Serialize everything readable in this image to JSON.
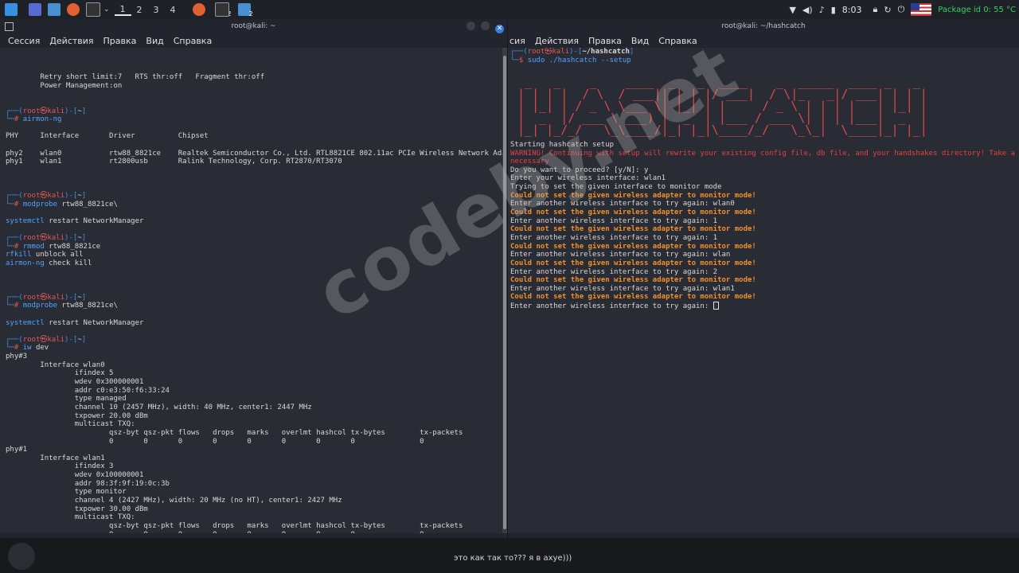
{
  "taskbar": {
    "workspaces": [
      "1",
      "2",
      "3",
      "4"
    ],
    "active_workspace": "1",
    "badge_a": "2",
    "badge_b": "2",
    "clock": "8:03",
    "package_status": "Package id 0: 55 °C"
  },
  "left_window": {
    "title": "root@kali: ~",
    "menu": [
      "Сессия",
      "Действия",
      "Правка",
      "Вид",
      "Справка"
    ],
    "lines": [
      {
        "t": "        Retry short limit:7   RTS thr:off   Fragment thr:off"
      },
      {
        "t": "        Power Management:on"
      },
      {
        "t": ""
      },
      {
        "t": ""
      },
      {
        "prompt": true,
        "host": "root㉿kali",
        "path": "~"
      },
      {
        "cmd": "airmon-ng"
      },
      {
        "t": ""
      },
      {
        "t": "PHY     Interface       Driver          Chipset"
      },
      {
        "t": ""
      },
      {
        "t": "phy2    wlan0           rtw88_8821ce    Realtek Semiconductor Co., Ltd. RTL8821CE 802.11ac PCIe Wireless Network Ada"
      },
      {
        "t": "phy1    wlan1           rt2800usb       Ralink Technology, Corp. RT2870/RT3070"
      },
      {
        "t": ""
      },
      {
        "t": ""
      },
      {
        "t": ""
      },
      {
        "prompt": true,
        "host": "root㉿kali",
        "path": "~"
      },
      {
        "cmd": "modprobe",
        "arg": "rtw88_8821ce\\"
      },
      {
        "t": ""
      },
      {
        "t2": "systemctl",
        "arg": "restart NetworkManager"
      },
      {
        "t": ""
      },
      {
        "prompt": true,
        "host": "root㉿kali",
        "path": "~"
      },
      {
        "cmd": "rmmod",
        "arg": "rtw88_8821ce"
      },
      {
        "t2": "rfkill",
        "arg": "unblock all"
      },
      {
        "t2": "airmon-ng",
        "arg": "check kill"
      },
      {
        "t": ""
      },
      {
        "t": ""
      },
      {
        "t": ""
      },
      {
        "prompt": true,
        "host": "root㉿kali",
        "path": "~"
      },
      {
        "cmd": "modprobe",
        "arg": "rtw88_8821ce\\"
      },
      {
        "t": ""
      },
      {
        "t2": "systemctl",
        "arg": "restart NetworkManager"
      },
      {
        "t": ""
      },
      {
        "prompt": true,
        "host": "root㉿kali",
        "path": "~"
      },
      {
        "cmd": "iw",
        "arg": "dev"
      },
      {
        "t": "phy#3"
      },
      {
        "t": "        Interface wlan0"
      },
      {
        "t": "                ifindex 5"
      },
      {
        "t": "                wdev 0x300000001"
      },
      {
        "t": "                addr c0:e3:50:f6:33:24"
      },
      {
        "t": "                type managed"
      },
      {
        "t": "                channel 10 (2457 MHz), width: 40 MHz, center1: 2447 MHz"
      },
      {
        "t": "                txpower 20.00 dBm"
      },
      {
        "t": "                multicast TXQ:"
      },
      {
        "t": "                        qsz-byt qsz-pkt flows   drops   marks   overlmt hashcol tx-bytes        tx-packets"
      },
      {
        "t": "                        0       0       0       0       0       0       0       0               0"
      },
      {
        "t": "phy#1"
      },
      {
        "t": "        Interface wlan1"
      },
      {
        "t": "                ifindex 3"
      },
      {
        "t": "                wdev 0x100000001"
      },
      {
        "t": "                addr 98:3f:9f:19:0c:3b"
      },
      {
        "t": "                type monitor"
      },
      {
        "t": "                channel 4 (2427 MHz), width: 20 MHz (no HT), center1: 2427 MHz"
      },
      {
        "t": "                txpower 30.00 dBm"
      },
      {
        "t": "                multicast TXQ:"
      },
      {
        "t": "                        qsz-byt qsz-pkt flows   drops   marks   overlmt hashcol tx-bytes        tx-packets"
      },
      {
        "t": "                        0       0       0       0       0       0       0       0               0"
      },
      {
        "t": ""
      },
      {
        "t": ""
      },
      {
        "prompt": true,
        "host": "root㉿kali",
        "path": "~"
      },
      {
        "cursor": true
      }
    ]
  },
  "right_window": {
    "title": "root@kali: ~/hashcatch",
    "menu": [
      "сия",
      "Действия",
      "Правка",
      "Вид",
      "Справка"
    ],
    "prompt_host": "root㉿kali",
    "prompt_path": "~/hashcatch",
    "command": "sudo ./hashcatch --setup",
    "logo_lines": [
      "  _   _    _    ____  _   _  ____    _  _____  ____ _   _ ",
      " | | | |  / \\  / ___|| | | |/ ___|  / \\|_   _|/ ___| | | |",
      " | |_| | / _ \\ \\___ \\| |_| | |     / _ \\ | | | |   | |_| |",
      " |  _  |/ ___ \\ ___) |  _  | |___ / ___ \\| | | |___|  _  |",
      " |_| |_/_/   \\_\\____/|_| |_|\\____/_/   \\_\\_|  \\____|_| |_|"
    ],
    "lines": [
      {
        "t": "Starting hashcatch setup"
      },
      {
        "red": "WARNING! Continuing with setup will rewrite your existing config file, db file, and your handshakes directory! Take a ba"
      },
      {
        "red": "necessary"
      },
      {
        "t": "Do you want to proceed? [y/N]: y"
      },
      {
        "t": "Enter your wireless interface: wlan1"
      },
      {
        "t": "Trying to set the given interface to monitor mode"
      },
      {
        "err": "Could not set the given wireless adapter to monitor mode!"
      },
      {
        "t": "Enter another wireless interface to try again: wlan0"
      },
      {
        "err": "Could not set the given wireless adapter to monitor mode!"
      },
      {
        "t": "Enter another wireless interface to try again: 1"
      },
      {
        "err": "Could not set the given wireless adapter to monitor mode!"
      },
      {
        "t": "Enter another wireless interface to try again: 1"
      },
      {
        "err": "Could not set the given wireless adapter to monitor mode!"
      },
      {
        "t": "Enter another wireless interface to try again: wlan"
      },
      {
        "err": "Could not set the given wireless adapter to monitor mode!"
      },
      {
        "t": "Enter another wireless interface to try again: 2"
      },
      {
        "err": "Could not set the given wireless adapter to monitor mode!"
      },
      {
        "t": "Enter another wireless interface to try again: wlan1"
      },
      {
        "err": "Could not set the given wireless adapter to monitor mode!"
      },
      {
        "t": "Enter another wireless interface to try again: ",
        "cursor": true
      }
    ]
  },
  "bottom_bar": {
    "chat_message": "это как так то??? я в ахуе)))"
  },
  "watermark": "codeby.net",
  "colors": {
    "prompt_frame": "#3b8eea",
    "prompt_user": "#e05858",
    "error": "#f0902a",
    "warning": "#e44040"
  }
}
